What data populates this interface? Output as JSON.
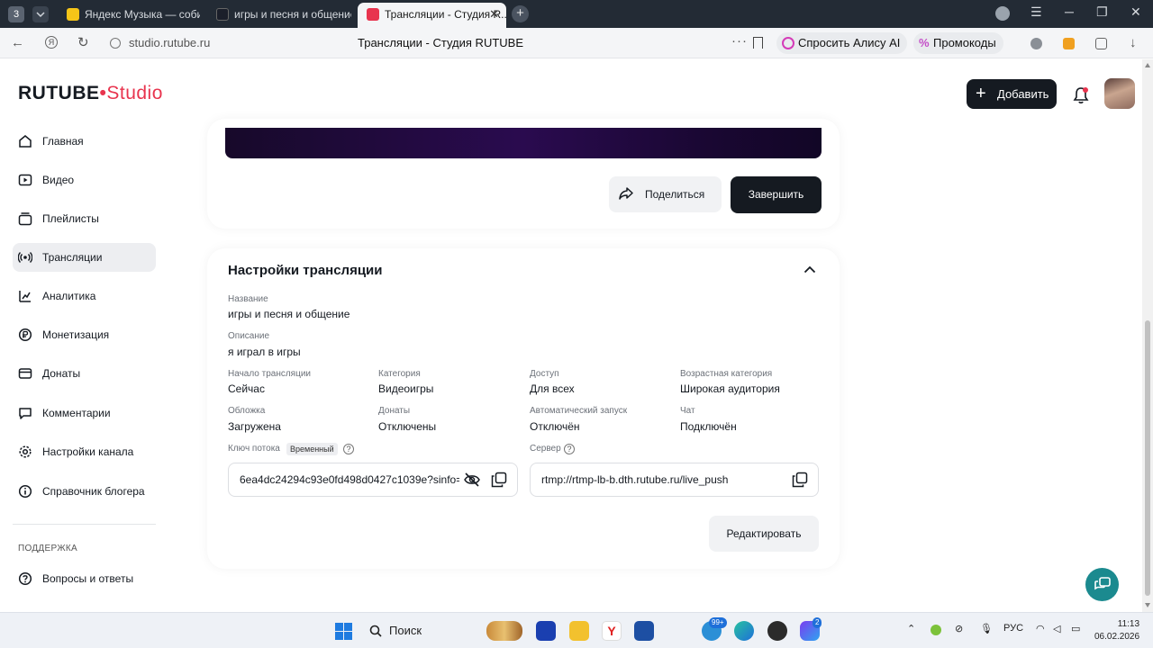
{
  "browser": {
    "workspace_label": "3",
    "tabs": [
      {
        "title": "Яндекс Музыка — собир..."
      },
      {
        "title": "игры и песня и общение"
      },
      {
        "title": "Трансляции - Студия R..."
      }
    ],
    "url": "studio.rutube.ru",
    "page_title": "Трансляции - Студия RUTUBE",
    "alisa_label": "Спросить Алису AI",
    "promo_label": "Промокоды"
  },
  "header": {
    "logo_main": "RUTUBE",
    "logo_studio": "Studio",
    "add_button": "Добавить"
  },
  "sidebar": {
    "items": [
      {
        "label": "Главная",
        "icon": "home-icon"
      },
      {
        "label": "Видео",
        "icon": "video-icon"
      },
      {
        "label": "Плейлисты",
        "icon": "playlist-icon"
      },
      {
        "label": "Трансляции",
        "icon": "broadcast-icon",
        "active": true
      },
      {
        "label": "Аналитика",
        "icon": "analytics-icon"
      },
      {
        "label": "Монетизация",
        "icon": "monetization-icon"
      },
      {
        "label": "Донаты",
        "icon": "donate-icon"
      },
      {
        "label": "Комментарии",
        "icon": "comments-icon"
      },
      {
        "label": "Настройки канала",
        "icon": "gear-icon"
      },
      {
        "label": "Справочник блогера",
        "icon": "guide-icon"
      }
    ],
    "support_heading": "ПОДДЕРЖКА",
    "support_items": [
      {
        "label": "Вопросы и ответы",
        "icon": "help-icon"
      }
    ]
  },
  "broadcast": {
    "share_label": "Поделиться",
    "finish_label": "Завершить"
  },
  "settings": {
    "title": "Настройки трансляции",
    "name_label": "Название",
    "name_value": "игры и песня и общение",
    "description_label": "Описание",
    "description_value": "я играл в игры",
    "grid": [
      {
        "label": "Начало трансляции",
        "value": "Сейчас"
      },
      {
        "label": "Категория",
        "value": "Видеоигры"
      },
      {
        "label": "Доступ",
        "value": "Для всех"
      },
      {
        "label": "Возрастная категория",
        "value": "Широкая аудитория"
      },
      {
        "label": "Обложка",
        "value": "Загружена"
      },
      {
        "label": "Донаты",
        "value": "Отключены"
      },
      {
        "label": "Автоматический запуск",
        "value": "Отключён"
      },
      {
        "label": "Чат",
        "value": "Подключён"
      }
    ],
    "stream_key_label": "Ключ потока",
    "stream_key_badge": "Временный",
    "stream_key_value": "6ea4dc24294c93e0fd498d0427c1039e?sinfo=",
    "server_label": "Сервер",
    "server_value": "rtmp://rtmp-lb-b.dth.rutube.ru/live_push",
    "edit_label": "Редактировать"
  },
  "taskbar": {
    "search_label": "Поиск",
    "badge_count": "99+",
    "badge_count_2": "2",
    "language": "РУС",
    "time": "11:13",
    "date": "06.02.2026"
  },
  "colors": {
    "brand_red": "#e8344e",
    "dark": "#151a21",
    "active_bg": "#edeef1",
    "float_teal": "#1b8a8f"
  }
}
